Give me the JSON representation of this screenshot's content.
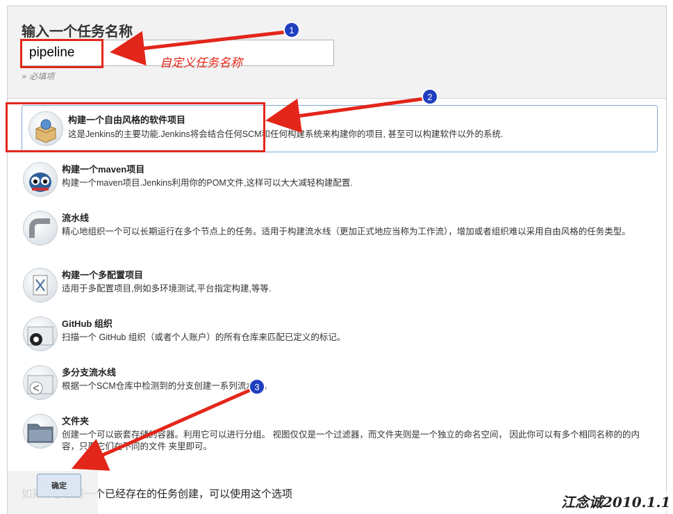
{
  "form": {
    "title": "输入一个任务名称",
    "name_value": "pipeline",
    "required_hint": "» 必填项"
  },
  "items": [
    {
      "name": "构建一个自由风格的软件项目",
      "desc": "这是Jenkins的主要功能.Jenkins将会结合任何SCM和任何构建系统来构建你的项目, 甚至可以构建软件以外的系统.",
      "icon": "package-box-icon"
    },
    {
      "name": "构建一个maven项目",
      "desc": "构建一个maven项目.Jenkins利用你的POM文件,这样可以大大减轻构建配置.",
      "icon": "maven-owl-icon"
    },
    {
      "name": "流水线",
      "desc": "精心地组织一个可以长期运行在多个节点上的任务。适用于构建流水线（更加正式地应当称为工作流），增加或者组织难以采用自由风格的任务类型。",
      "icon": "pipe-icon"
    },
    {
      "name": "构建一个多配置项目",
      "desc": "适用于多配置项目,例如多环境测试,平台指定构建,等等.",
      "icon": "config-tools-icon"
    },
    {
      "name": "GitHub 组织",
      "desc": "扫描一个 GitHub 组织（或者个人账户）的所有仓库来匹配已定义的标记。",
      "icon": "github-folder-icon"
    },
    {
      "name": "多分支流水线",
      "desc": "根据一个SCM仓库中检测到的分支创建一系列流水线。",
      "icon": "branch-folder-icon"
    },
    {
      "name": "文件夹",
      "desc": "创建一个可以嵌套存储的容器。利用它可以进行分组。 视图仅仅是一个过滤器，而文件夹则是一个独立的命名空间， 因此你可以有多个相同名称的的内容，只要它们在不同的文件 夹里即可。",
      "icon": "folder-icon"
    }
  ],
  "copy_hint": "如果你想根据一个已经存在的任务创建，可以使用这个选项",
  "ok_label": "确定",
  "annotations": {
    "custom_name": "自定义任务名称",
    "step1": "1",
    "step2": "2",
    "step3": "3"
  },
  "watermark": "江念诚2010.1.1",
  "colors": {
    "annotation_red": "#e3261a",
    "badge_blue": "#1f3fbf",
    "selected_border": "#7fa8d8"
  }
}
